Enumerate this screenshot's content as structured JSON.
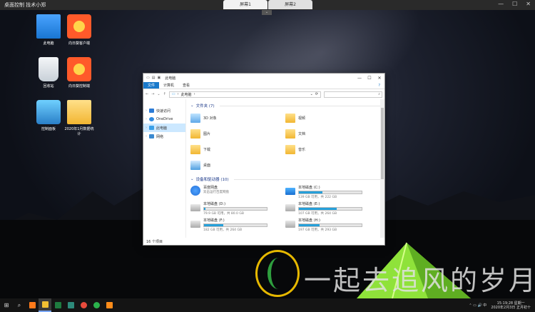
{
  "remote": {
    "title": "桌面控制  技术小郑",
    "tabs": [
      {
        "label": "屏幕1"
      },
      {
        "label": "屏幕2"
      }
    ],
    "chevron": "⌄",
    "controls": {
      "minimize": "—",
      "maximize": "☐",
      "close": "✕"
    }
  },
  "desktop_icons": [
    {
      "label": "此电脑",
      "icon": "computer-icon"
    },
    {
      "label": "向日葵客户端",
      "icon": "sunflower-icon"
    },
    {
      "label": "回收站",
      "icon": "recycle-bin-icon"
    },
    {
      "label": "向日葵控制端",
      "icon": "sunflower-icon"
    },
    {
      "label": "控制面板",
      "icon": "control-panel-icon"
    },
    {
      "label": "2020年1月数据统计",
      "icon": "folder-icon"
    }
  ],
  "explorer": {
    "title": "此电脑",
    "window_controls": {
      "minimize": "—",
      "maximize": "☐",
      "close": "✕"
    },
    "ribbon": {
      "file": "文件",
      "computer": "计算机",
      "view": "查看",
      "help": "?"
    },
    "nav": {
      "back": "←",
      "forward": "→",
      "recent": "⌄",
      "up": "↑"
    },
    "address": {
      "path": "此电脑",
      "separator": "›",
      "dropdown": "⌄",
      "refresh": "⟳"
    },
    "search_placeholder": "",
    "search_icon": "⌕",
    "sidebar": [
      {
        "label": "快速访问",
        "color": "#2b7bd6"
      },
      {
        "label": "OneDrive",
        "color": "#2f8ae0"
      },
      {
        "label": "此电脑",
        "color": "#3aa0e8",
        "selected": true
      },
      {
        "label": "网络",
        "color": "#3a8ad0"
      }
    ],
    "folders_section": {
      "title": "文件夹 (7)",
      "arrow": "⌄"
    },
    "folders": [
      {
        "label": "3D 对象"
      },
      {
        "label": "视频"
      },
      {
        "label": "图片"
      },
      {
        "label": "文档"
      },
      {
        "label": "下载"
      },
      {
        "label": "音乐"
      },
      {
        "label": "桌面"
      }
    ],
    "devices_section": {
      "title": "设备和驱动器 (10)",
      "arrow": "⌄"
    },
    "drives": [
      {
        "name": "百度网盘",
        "free": "双击运行百度网盘",
        "usage": null,
        "type": "baidu"
      },
      {
        "name": "本地磁盘 (C:)",
        "free": "139 GB 可用，共 222 GB",
        "usage": 0.37,
        "type": "win"
      },
      {
        "name": "本地磁盘 (D:)",
        "free": "79.9 GB 可用，共 80.0 GB",
        "usage": 0.02,
        "type": "disk"
      },
      {
        "name": "本地磁盘 (E:)",
        "free": "107 GB 可用，共 264 GB",
        "usage": 0.6,
        "type": "disk"
      },
      {
        "name": "本地磁盘 (F:)",
        "free": "182 GB 可用，共 264 GB",
        "usage": 0.31,
        "type": "disk"
      },
      {
        "name": "本地磁盘 (H:)",
        "free": "197 GB 可用，共 293 GB",
        "usage": 0.33,
        "type": "disk"
      }
    ],
    "status": "16 个项目"
  },
  "watermark": {
    "text": "一起去追风的岁月"
  },
  "taskbar": {
    "start": "⊞",
    "search": "⌕",
    "apps": [
      {
        "name": "sunflower",
        "color": "#ff7a1a"
      },
      {
        "name": "file-explorer",
        "color": "#f2c032",
        "active": true
      },
      {
        "name": "excel",
        "color": "#1e7b3f"
      },
      {
        "name": "video",
        "color": "#2d8a7a"
      },
      {
        "name": "chrome",
        "color": "#e84b3c"
      },
      {
        "name": "wechat",
        "color": "#2bb24c"
      },
      {
        "name": "app",
        "color": "#ff8c1a"
      }
    ],
    "tray_icons": "⌃  ▭  🔊  中",
    "time": "15:19:28 星期一",
    "date": "2020年2月3日 正月初十"
  }
}
